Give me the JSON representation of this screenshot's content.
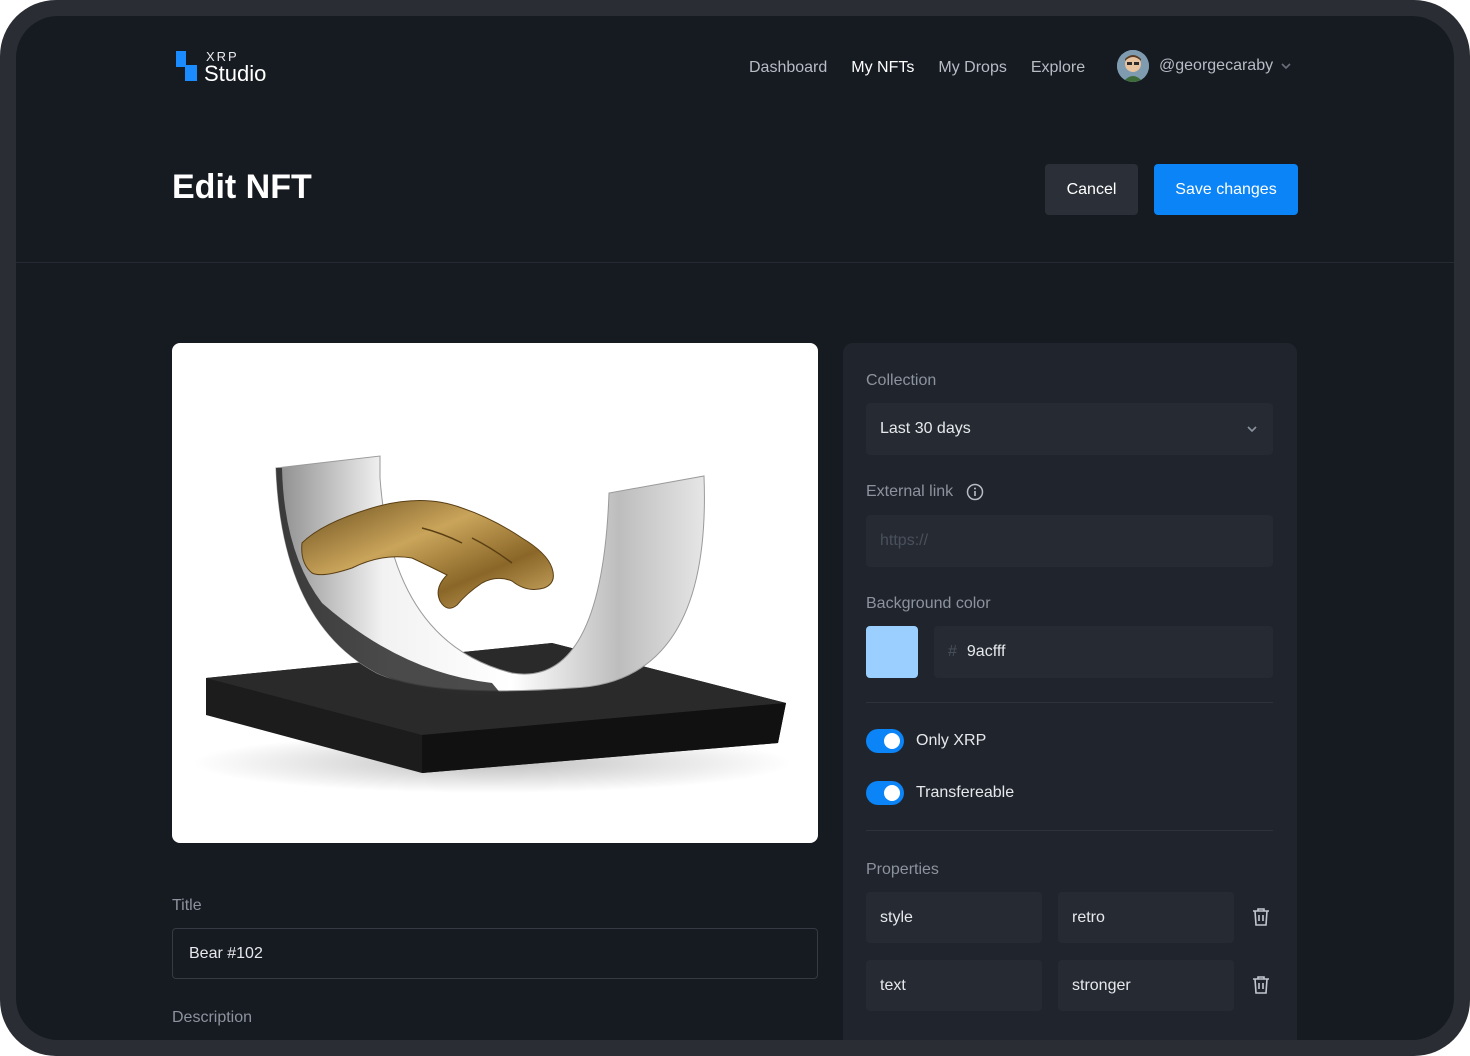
{
  "brand": {
    "small": "XRP",
    "big": "Studio"
  },
  "nav": {
    "links": [
      "Dashboard",
      "My NFTs",
      "My Drops",
      "Explore"
    ],
    "active": "My NFTs",
    "user": "@georgecaraby"
  },
  "page": {
    "title": "Edit NFT",
    "cancel_label": "Cancel",
    "save_label": "Save changes"
  },
  "form": {
    "title_label": "Title",
    "title_value": "Bear #102",
    "description_label": "Description"
  },
  "panel": {
    "collection_label": "Collection",
    "collection_value": "Last 30 days",
    "external_link_label": "External link",
    "external_link_placeholder": "https://",
    "background_color_label": "Background color",
    "background_color_hash": "#",
    "background_color_value": "9acfff",
    "toggles": [
      {
        "label": "Only XRP",
        "on": true
      },
      {
        "label": "Transfereable",
        "on": true
      }
    ],
    "properties_label": "Properties",
    "properties": [
      {
        "key": "style",
        "value": "retro"
      },
      {
        "key": "text",
        "value": "stronger"
      }
    ]
  },
  "colors": {
    "accent": "#0a84f7",
    "background": "#161a21",
    "panel": "#20242c",
    "swatch": "#9acfff"
  }
}
